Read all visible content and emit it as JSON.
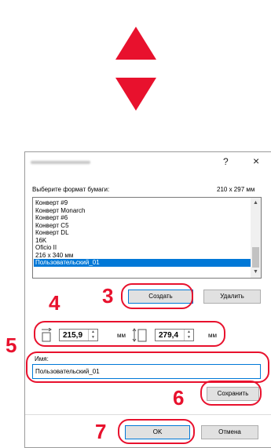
{
  "colors": {
    "accent_red": "#e8112d",
    "selection_blue": "#0078d7"
  },
  "dialog": {
    "title_icon": "blurred-title",
    "help_label": "?",
    "close_label": "×",
    "format_label": "Выберите формат бумаги:",
    "size_readout": "210 x 297 мм",
    "paper_list": [
      "Конверт #9",
      "Конверт Monarch",
      "Конверт #6",
      "Конверт C5",
      "Конверт DL",
      "16K",
      "Oficio II",
      "216 x 340 мм",
      "Пользовательский_01"
    ],
    "selected_paper": "Пользовательский_01",
    "create_button": "Создать",
    "delete_button": "Удалить",
    "width_value": "215,9",
    "height_value": "279,4",
    "unit_mm": "мм",
    "unit_mm_2": "мм",
    "name_label": "Имя:",
    "name_value": "Пользовательский_01",
    "save_button": "Сохранить",
    "ok_button": "OK",
    "cancel_button": "Отмена"
  },
  "callouts": {
    "c3": "3",
    "c4": "4",
    "c5": "5",
    "c6": "6",
    "c7": "7"
  }
}
